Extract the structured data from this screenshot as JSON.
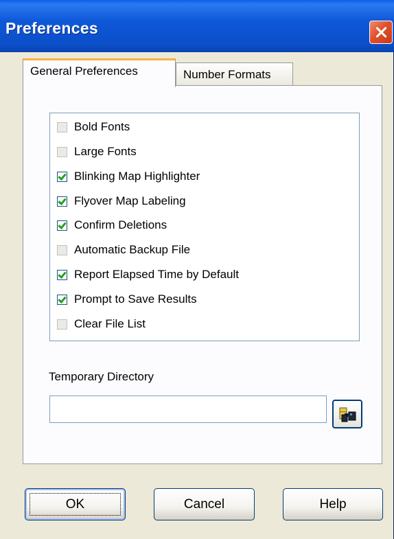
{
  "window": {
    "title": "Preferences",
    "close_icon": "close-icon"
  },
  "tabs": [
    {
      "label": "General Preferences",
      "active": true
    },
    {
      "label": "Number Formats",
      "active": false
    }
  ],
  "options": [
    {
      "label": "Bold Fonts",
      "checked": false
    },
    {
      "label": "Large Fonts",
      "checked": false
    },
    {
      "label": "Blinking Map Highlighter",
      "checked": true
    },
    {
      "label": "Flyover Map Labeling",
      "checked": true
    },
    {
      "label": "Confirm Deletions",
      "checked": true
    },
    {
      "label": "Automatic Backup File",
      "checked": false
    },
    {
      "label": "Report Elapsed Time by Default",
      "checked": true
    },
    {
      "label": "Prompt to Save Results",
      "checked": true
    },
    {
      "label": "Clear File List",
      "checked": false
    }
  ],
  "temp_dir": {
    "label": "Temporary Directory",
    "value": "",
    "browse_icon": "binoculars-icon"
  },
  "buttons": {
    "ok": "OK",
    "cancel": "Cancel",
    "help": "Help"
  },
  "colors": {
    "title_bar": "#0b4fc9",
    "close_button": "#e0502b",
    "active_tab_highlight": "#f8b040",
    "check_mark": "#21a121",
    "dialog_background": "#ece9d8"
  }
}
